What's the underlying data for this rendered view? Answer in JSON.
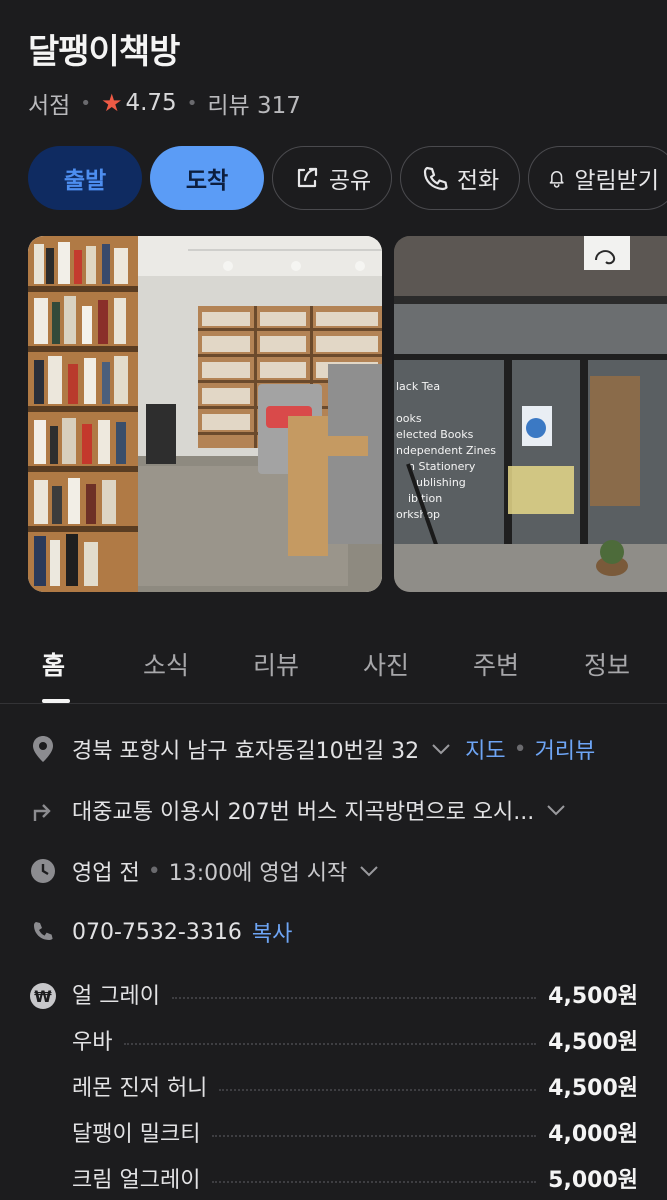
{
  "place": {
    "name": "달팽이책방",
    "category": "서점",
    "rating": "4.75",
    "review_label": "리뷰 317"
  },
  "actions": {
    "depart": "출발",
    "arrive": "도착",
    "share": "공유",
    "call": "전화",
    "alarm": "알림받기"
  },
  "tabs": [
    {
      "label": "홈"
    },
    {
      "label": "소식"
    },
    {
      "label": "리뷰"
    },
    {
      "label": "사진"
    },
    {
      "label": "주변"
    },
    {
      "label": "정보"
    }
  ],
  "info": {
    "address": "경북 포항시 남구 효자동길10번길 32",
    "map_link": "지도",
    "roadview_link": "거리뷰",
    "transit": "대중교통 이용시 207번 버스 지곡방면으로 오시...",
    "hours_status": "영업 전",
    "hours_detail": "13:00에 영업 시작",
    "phone": "070-7532-3316",
    "copy_link": "복사"
  },
  "menu": [
    {
      "name": "얼 그레이",
      "price": "4,500원"
    },
    {
      "name": "우바",
      "price": "4,500원"
    },
    {
      "name": "레몬 진저 허니",
      "price": "4,500원"
    },
    {
      "name": "달팽이 밀크티",
      "price": "4,000원"
    },
    {
      "name": "크림 얼그레이",
      "price": "5,000원"
    }
  ],
  "photo_texts": [
    "lack Tea",
    "ooks",
    "elected Books",
    "ndependent Zines",
    "n Stationery",
    "ublishing",
    "ibition",
    "orkshop"
  ],
  "colors": {
    "background": "#1c1c1e",
    "accent_blue": "#5b9cf6",
    "depart_bg": "#0f2b61",
    "star": "#ef5a45",
    "link": "#6ea5f5"
  }
}
